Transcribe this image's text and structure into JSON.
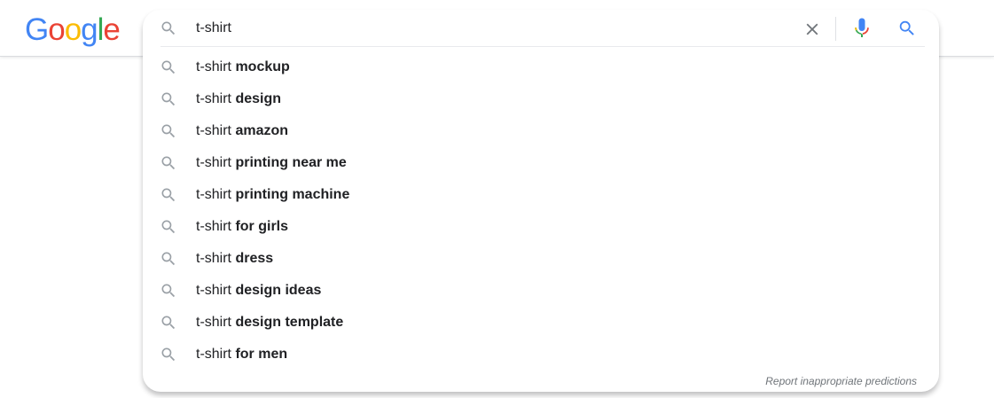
{
  "logo": {
    "letters": [
      "G",
      "o",
      "o",
      "g",
      "l",
      "e"
    ],
    "colors": [
      "#4285F4",
      "#EA4335",
      "#FBBC05",
      "#4285F4",
      "#34A853",
      "#EA4335"
    ]
  },
  "search": {
    "query": "t-shirt",
    "icons": {
      "leading": "search-icon",
      "clear": "close-icon",
      "mic": "mic-icon",
      "submit": "search-icon"
    }
  },
  "suggestions": [
    {
      "prefix": "t-shirt",
      "completion": "mockup"
    },
    {
      "prefix": "t-shirt",
      "completion": "design"
    },
    {
      "prefix": "t-shirt",
      "completion": "amazon"
    },
    {
      "prefix": "t-shirt",
      "completion": "printing near me"
    },
    {
      "prefix": "t-shirt",
      "completion": "printing machine"
    },
    {
      "prefix": "t-shirt",
      "completion": "for girls"
    },
    {
      "prefix": "t-shirt",
      "completion": "dress"
    },
    {
      "prefix": "t-shirt",
      "completion": "design ideas"
    },
    {
      "prefix": "t-shirt",
      "completion": "design template"
    },
    {
      "prefix": "t-shirt",
      "completion": "for men"
    }
  ],
  "report_link": "Report inappropriate predictions",
  "colors": {
    "accent_blue": "#4285F4",
    "icon_gray": "#9aa0a6",
    "text": "#202124",
    "muted": "#70757a"
  }
}
